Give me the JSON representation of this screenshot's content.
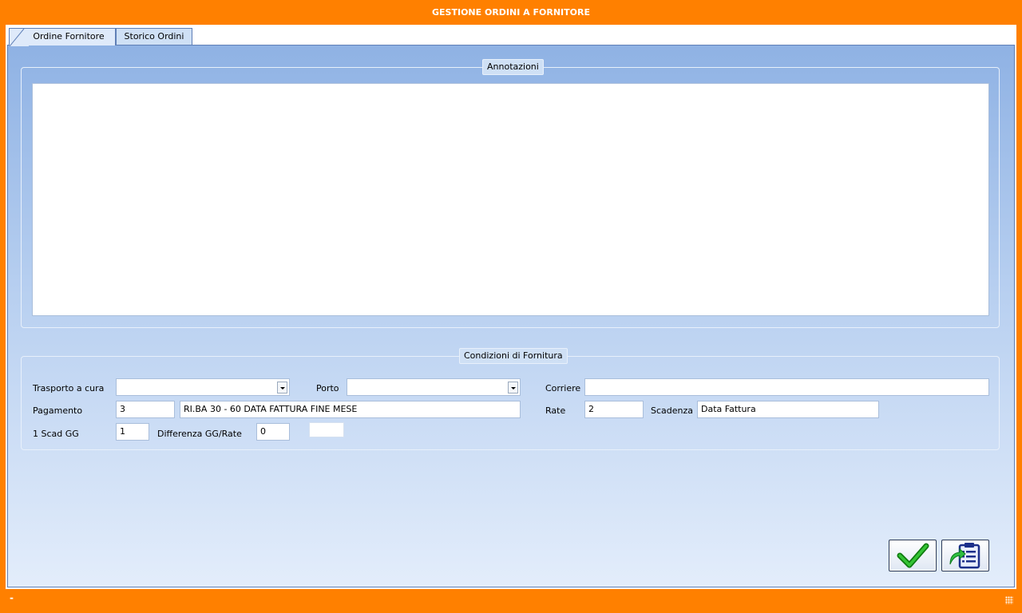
{
  "window": {
    "title": "GESTIONE ORDINI A FORNITORE"
  },
  "tabs": [
    {
      "label": "Ordine Fornitore",
      "active": true
    },
    {
      "label": "Storico Ordini",
      "active": false
    }
  ],
  "annotazioni": {
    "legend": "Annotazioni",
    "text": ""
  },
  "condizioni": {
    "legend": "Condizioni di Fornitura",
    "trasporto": {
      "label": "Trasporto a cura",
      "value": ""
    },
    "porto": {
      "label": "Porto",
      "value": ""
    },
    "corriere": {
      "label": "Corriere",
      "value": ""
    },
    "pagamento": {
      "label": "Pagamento",
      "code": "3",
      "description": "RI.BA 30 - 60 DATA FATTURA FINE MESE"
    },
    "rate": {
      "label": "Rate",
      "value": "2"
    },
    "scadenza": {
      "label": "Scadenza",
      "value": "Data Fattura"
    },
    "prima_scad": {
      "label": "1 Scad GG",
      "value": "1"
    },
    "differenza": {
      "label": "Differenza GG/Rate",
      "value": "0",
      "extra": ""
    }
  },
  "buttons": [
    {
      "icon": "checkmark-icon",
      "accent": "#1e9a1e"
    },
    {
      "icon": "clipboard-export-icon",
      "accent": "#1c2f8a"
    }
  ],
  "statusbar": {
    "text": "-"
  },
  "colors": {
    "frame": "#ff8000",
    "tab_border": "#5f7fb6"
  }
}
